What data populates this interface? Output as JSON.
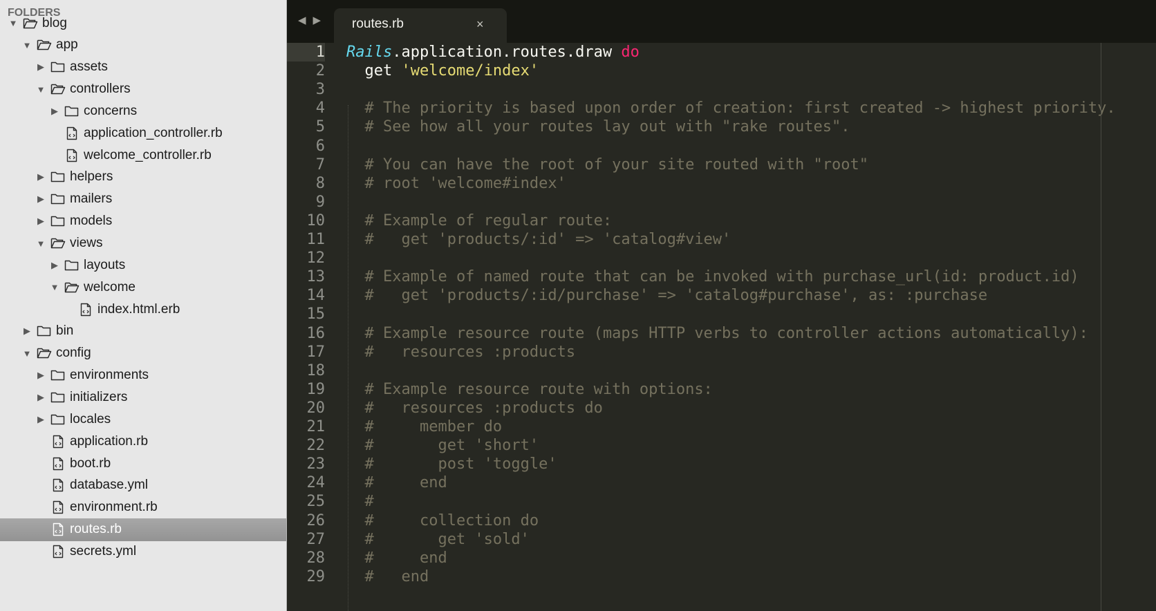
{
  "sidebar": {
    "header": "FOLDERS",
    "items": [
      {
        "label": "blog",
        "kind": "folder",
        "expanded": true,
        "depth": 0
      },
      {
        "label": "app",
        "kind": "folder",
        "expanded": true,
        "depth": 1
      },
      {
        "label": "assets",
        "kind": "folder",
        "expanded": false,
        "depth": 2
      },
      {
        "label": "controllers",
        "kind": "folder",
        "expanded": true,
        "depth": 2
      },
      {
        "label": "concerns",
        "kind": "folder",
        "expanded": false,
        "depth": 3
      },
      {
        "label": "application_controller.rb",
        "kind": "file",
        "depth": 3
      },
      {
        "label": "welcome_controller.rb",
        "kind": "file",
        "depth": 3
      },
      {
        "label": "helpers",
        "kind": "folder",
        "expanded": false,
        "depth": 2
      },
      {
        "label": "mailers",
        "kind": "folder",
        "expanded": false,
        "depth": 2
      },
      {
        "label": "models",
        "kind": "folder",
        "expanded": false,
        "depth": 2
      },
      {
        "label": "views",
        "kind": "folder",
        "expanded": true,
        "depth": 2
      },
      {
        "label": "layouts",
        "kind": "folder",
        "expanded": false,
        "depth": 3
      },
      {
        "label": "welcome",
        "kind": "folder",
        "expanded": true,
        "depth": 3
      },
      {
        "label": "index.html.erb",
        "kind": "file",
        "depth": 4
      },
      {
        "label": "bin",
        "kind": "folder",
        "expanded": false,
        "depth": 1
      },
      {
        "label": "config",
        "kind": "folder",
        "expanded": true,
        "depth": 1
      },
      {
        "label": "environments",
        "kind": "folder",
        "expanded": false,
        "depth": 2
      },
      {
        "label": "initializers",
        "kind": "folder",
        "expanded": false,
        "depth": 2
      },
      {
        "label": "locales",
        "kind": "folder",
        "expanded": false,
        "depth": 2
      },
      {
        "label": "application.rb",
        "kind": "file",
        "depth": 2
      },
      {
        "label": "boot.rb",
        "kind": "file",
        "depth": 2
      },
      {
        "label": "database.yml",
        "kind": "file",
        "depth": 2
      },
      {
        "label": "environment.rb",
        "kind": "file",
        "depth": 2
      },
      {
        "label": "routes.rb",
        "kind": "file",
        "depth": 2,
        "selected": true
      },
      {
        "label": "secrets.yml",
        "kind": "file",
        "depth": 2
      }
    ]
  },
  "tabbar": {
    "back_icon": "◀",
    "forward_icon": "▶",
    "tabs": [
      {
        "title": "routes.rb",
        "close": "×",
        "active": true
      }
    ]
  },
  "editor": {
    "current_line": 1,
    "colors": {
      "background": "#272822",
      "comment": "#75715e",
      "keyword": "#f92672",
      "string": "#e6db74",
      "constant": "#66d9ef",
      "plain": "#f8f8f2"
    },
    "lines": [
      {
        "num": "1",
        "tokens": [
          {
            "t": "const",
            "v": "Rails"
          },
          {
            "t": "plain",
            "v": ".application.routes.draw "
          },
          {
            "t": "kw",
            "v": "do"
          }
        ]
      },
      {
        "num": "2",
        "tokens": [
          {
            "t": "plain",
            "v": "  get "
          },
          {
            "t": "str",
            "v": "'welcome/index'"
          }
        ]
      },
      {
        "num": "3",
        "tokens": []
      },
      {
        "num": "4",
        "tokens": [
          {
            "t": "comment",
            "v": "  # The priority is based upon order of creation: first created -> highest priority."
          }
        ]
      },
      {
        "num": "5",
        "tokens": [
          {
            "t": "comment",
            "v": "  # See how all your routes lay out with \"rake routes\"."
          }
        ]
      },
      {
        "num": "6",
        "tokens": []
      },
      {
        "num": "7",
        "tokens": [
          {
            "t": "comment",
            "v": "  # You can have the root of your site routed with \"root\""
          }
        ]
      },
      {
        "num": "8",
        "tokens": [
          {
            "t": "comment",
            "v": "  # root 'welcome#index'"
          }
        ]
      },
      {
        "num": "9",
        "tokens": []
      },
      {
        "num": "10",
        "tokens": [
          {
            "t": "comment",
            "v": "  # Example of regular route:"
          }
        ]
      },
      {
        "num": "11",
        "tokens": [
          {
            "t": "comment",
            "v": "  #   get 'products/:id' => 'catalog#view'"
          }
        ]
      },
      {
        "num": "12",
        "tokens": []
      },
      {
        "num": "13",
        "tokens": [
          {
            "t": "comment",
            "v": "  # Example of named route that can be invoked with purchase_url(id: product.id)"
          }
        ]
      },
      {
        "num": "14",
        "tokens": [
          {
            "t": "comment",
            "v": "  #   get 'products/:id/purchase' => 'catalog#purchase', as: :purchase"
          }
        ]
      },
      {
        "num": "15",
        "tokens": []
      },
      {
        "num": "16",
        "tokens": [
          {
            "t": "comment",
            "v": "  # Example resource route (maps HTTP verbs to controller actions automatically):"
          }
        ]
      },
      {
        "num": "17",
        "tokens": [
          {
            "t": "comment",
            "v": "  #   resources :products"
          }
        ]
      },
      {
        "num": "18",
        "tokens": []
      },
      {
        "num": "19",
        "tokens": [
          {
            "t": "comment",
            "v": "  # Example resource route with options:"
          }
        ]
      },
      {
        "num": "20",
        "tokens": [
          {
            "t": "comment",
            "v": "  #   resources :products do"
          }
        ]
      },
      {
        "num": "21",
        "tokens": [
          {
            "t": "comment",
            "v": "  #     member do"
          }
        ]
      },
      {
        "num": "22",
        "tokens": [
          {
            "t": "comment",
            "v": "  #       get 'short'"
          }
        ]
      },
      {
        "num": "23",
        "tokens": [
          {
            "t": "comment",
            "v": "  #       post 'toggle'"
          }
        ]
      },
      {
        "num": "24",
        "tokens": [
          {
            "t": "comment",
            "v": "  #     end"
          }
        ]
      },
      {
        "num": "25",
        "tokens": [
          {
            "t": "comment",
            "v": "  #"
          }
        ]
      },
      {
        "num": "26",
        "tokens": [
          {
            "t": "comment",
            "v": "  #     collection do"
          }
        ]
      },
      {
        "num": "27",
        "tokens": [
          {
            "t": "comment",
            "v": "  #       get 'sold'"
          }
        ]
      },
      {
        "num": "28",
        "tokens": [
          {
            "t": "comment",
            "v": "  #     end"
          }
        ]
      },
      {
        "num": "29",
        "tokens": [
          {
            "t": "comment",
            "v": "  #   end"
          }
        ]
      }
    ]
  }
}
